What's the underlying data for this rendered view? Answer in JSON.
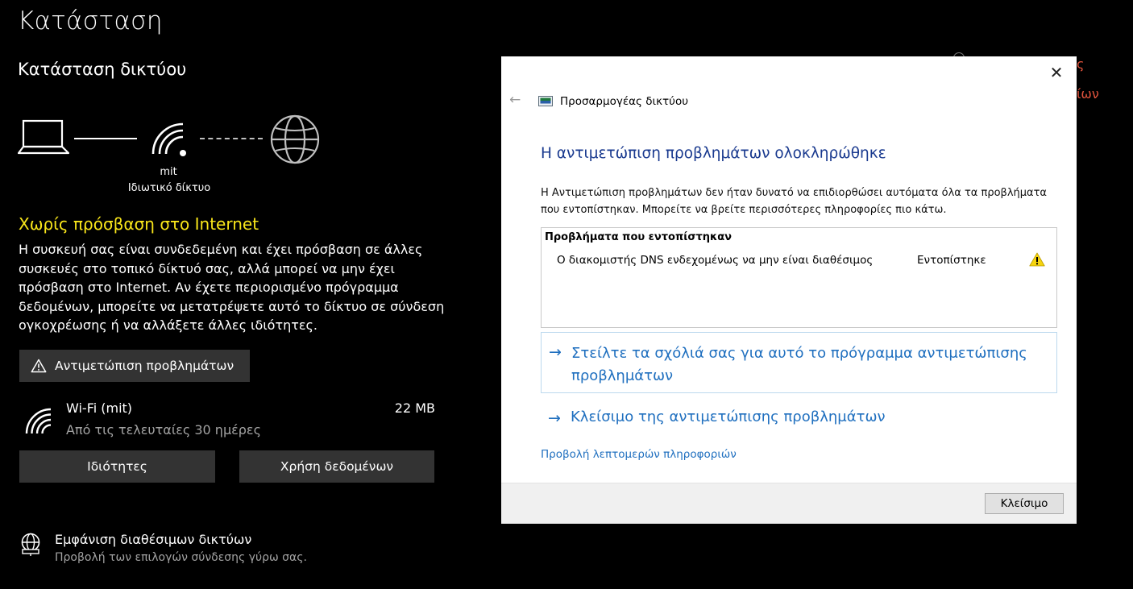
{
  "settings": {
    "page_title": "Κατάσταση",
    "section_title": "Κατάσταση δικτύου",
    "diagram": {
      "network_name": "mit",
      "network_type": "Ιδιωτικό δίκτυο"
    },
    "status": {
      "title": "Χωρίς πρόσβαση στο Internet",
      "title_color": "#f9e61a",
      "description": "Η συσκευή σας είναι συνδεδεμένη και έχει πρόσβαση σε άλλες συσκευές στο τοπικό δίκτυό σας, αλλά μπορεί να μην έχει πρόσβαση στο Internet. Αν έχετε περιορισμένο πρόγραμμα δεδομένων, μπορείτε να μετατρέψετε αυτό το δίκτυο σε σύνδεση ογκοχρέωσης ή να αλλάξετε άλλες ιδιότητες."
    },
    "troubleshoot_button": "Αντιμετώπιση προβλημάτων",
    "wifi": {
      "name": "Wi-Fi (mit)",
      "subtitle": "Από τις τελευταίες 30 ημέρες",
      "usage": "22 MB"
    },
    "properties_button": "Ιδιότητες",
    "data_usage_button": "Χρήση δεδομένων",
    "available_networks": {
      "title": "Εμφάνιση διαθέσιμων δικτύων",
      "subtitle": "Προβολή των επιλογών σύνδεσης γύρω σας."
    },
    "background_fragments": {
      "line1": "ς",
      "line2": "ίων"
    }
  },
  "dialog": {
    "app_name": "Προσαρμογέας δικτύου",
    "heading": "Η αντιμετώπιση προβλημάτων ολοκληρώθηκε",
    "description": "Η Αντιμετώπιση προβλημάτων δεν ήταν δυνατό να επιδιορθώσει αυτόματα όλα τα προβλήματα που εντοπίστηκαν. Μπορείτε να βρείτε περισσότερες πληροφορίες πιο κάτω.",
    "problems": {
      "header": "Προβλήματα που εντοπίστηκαν",
      "items": [
        {
          "text": "Ο διακομιστής DNS ενδεχομένως να μην είναι διαθέσιμος",
          "status": "Εντοπίστηκε",
          "icon": "warning-icon"
        }
      ]
    },
    "feedback_link": "Στείλτε τα σχόλιά σας για αυτό το πρόγραμμα αντιμετώπισης προβλημάτων",
    "close_troubleshooter_link": "Κλείσιμο της αντιμετώπισης προβλημάτων",
    "details_link": "Προβολή λεπτομερών πληροφοριών",
    "close_button": "Κλείσιμο",
    "heading_color": "#1a3a8f",
    "link_color": "#1f6fbf"
  }
}
